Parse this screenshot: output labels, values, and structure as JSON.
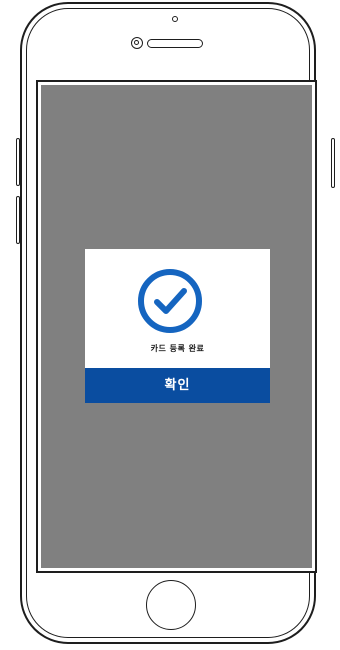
{
  "dialog": {
    "icon": "check-circle-icon",
    "message": "카드 등록 완료",
    "confirm_label": "확인"
  },
  "colors": {
    "overlay": "#808080",
    "accent": "#0a4da0",
    "check_ring": "#1565c0"
  },
  "device": {
    "frame_icon": "phone-frame",
    "home_button_icon": "home-button-icon"
  }
}
